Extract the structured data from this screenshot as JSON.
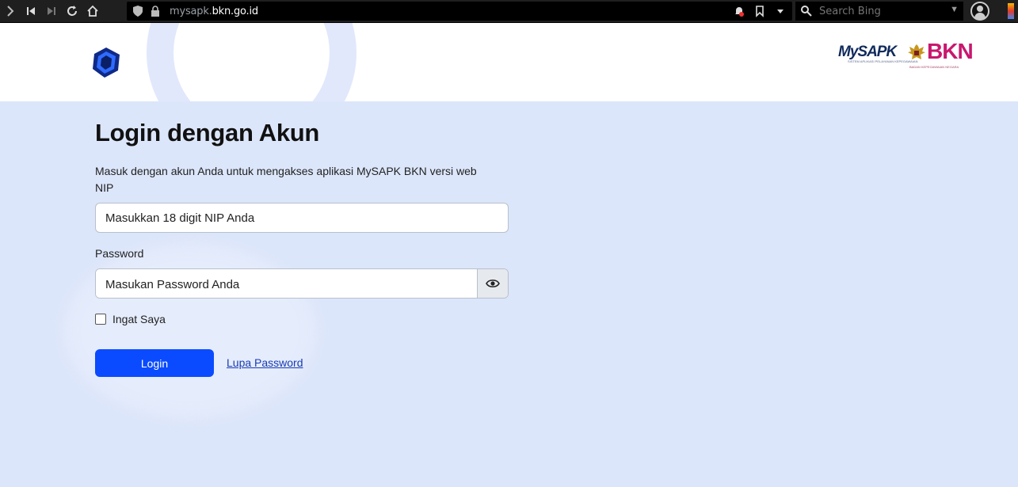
{
  "browser": {
    "url_prefix": "mysapk.",
    "url_domain": "bkn.go.id",
    "search_placeholder": "Search Bing"
  },
  "header": {
    "mysapk_logo_text": "MySAPK",
    "mysapk_tagline": "SISTEM APLIKASI PELAYANAN KEPEGAWAIAN",
    "bkn_logo_text": "BKN",
    "bkn_subtext": "BADAN KEPEGAWAIAN NEGARA"
  },
  "login": {
    "title": "Login dengan Akun",
    "description": "Masuk dengan akun Anda untuk mengakses aplikasi MySAPK BKN versi web",
    "nip_label": "NIP",
    "nip_placeholder": "Masukkan 18 digit NIP Anda",
    "password_label": "Password",
    "password_placeholder": "Masukan Password Anda",
    "remember_label": "Ingat Saya",
    "login_button": "Login",
    "forgot_link": "Lupa Password"
  },
  "colors": {
    "primary": "#0a4bff",
    "background": "#dce6fa",
    "bkn_brand": "#c8186e"
  }
}
